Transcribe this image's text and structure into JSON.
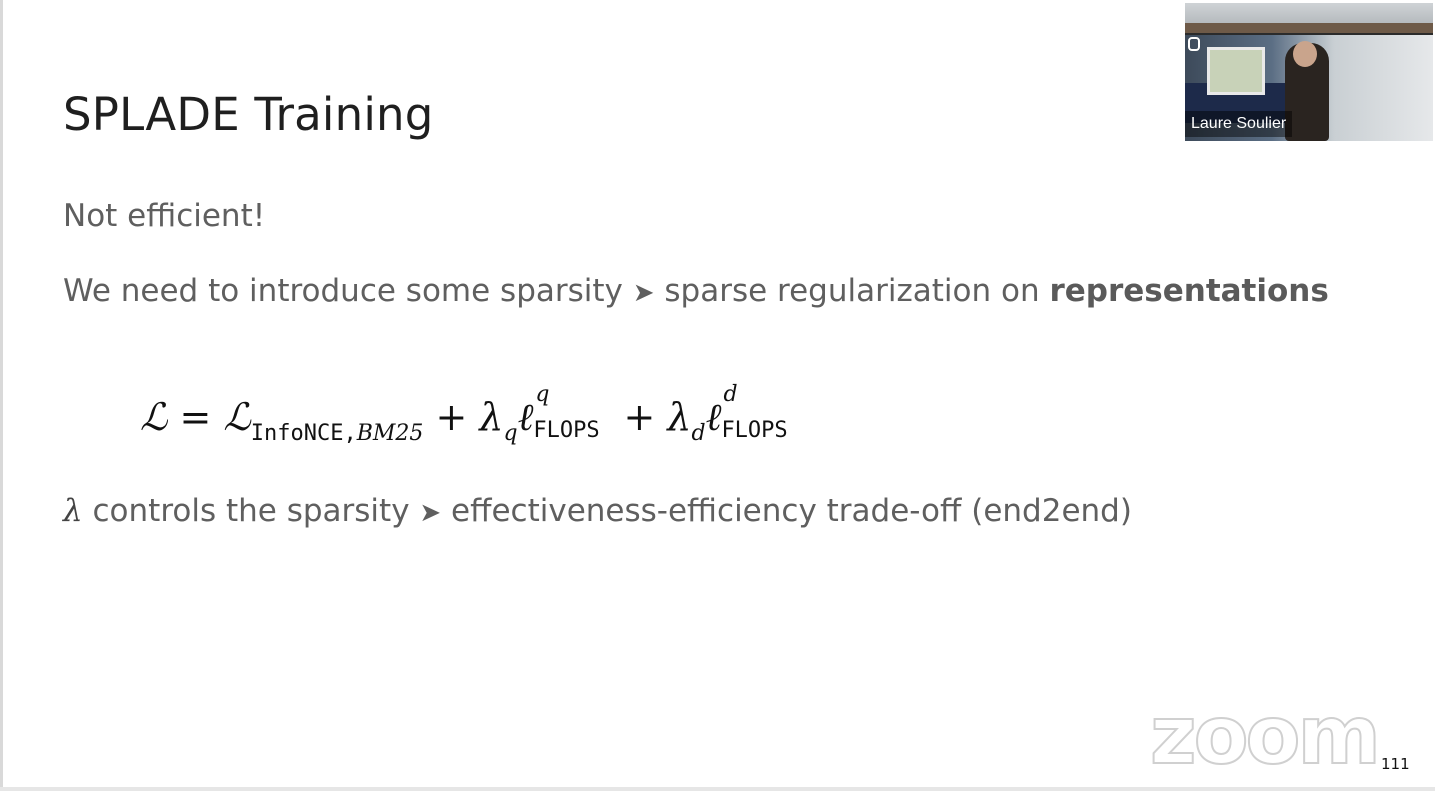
{
  "slide": {
    "title": "SPLADE Training",
    "line1": "Not efficient!",
    "line2_prefix": "We need to introduce some sparsity",
    "line2_arrow": "➤",
    "line2_mid": " sparse regularization on ",
    "line2_bold": "representations",
    "formula": {
      "lhs": "ℒ",
      "eq": " = ",
      "term1": "ℒ",
      "term1_sub_mono": "InfoNCE,",
      "term1_sub_it": "BM25",
      "plus1": " + ",
      "lambda_q": "λ",
      "lambda_q_sub": "q",
      "ell1": "ℓ",
      "ell1_sup": "q",
      "flops1": "FLOPS",
      "plus2": " + ",
      "lambda_d": "λ",
      "lambda_d_sub": "d",
      "ell2": "ℓ",
      "ell2_sup": "d",
      "flops2": "FLOPS"
    },
    "line3_lambda": "λ",
    "line3_text": " controls the sparsity ",
    "line3_arrow": "➤",
    "line3_rest": " effectiveness-efficiency trade-off (end2end)",
    "page_number": "111"
  },
  "video": {
    "participant_name": "Laure Soulier"
  },
  "watermark": {
    "text": "zoom"
  }
}
